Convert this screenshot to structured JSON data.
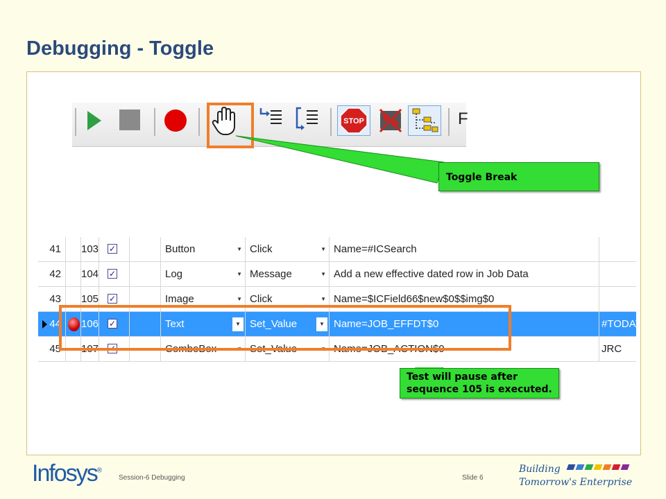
{
  "slide": {
    "title": "Debugging - Toggle"
  },
  "toolbar": {
    "items": [
      {
        "name": "run-icon",
        "color": "#2ea043"
      },
      {
        "name": "stop-icon",
        "color": "#8a8a8a"
      },
      {
        "name": "record-icon",
        "color": "#e00000"
      },
      {
        "name": "hand-icon",
        "color": "#222222"
      },
      {
        "name": "step-into-icon",
        "color": "#2a5db0"
      },
      {
        "name": "step-over-icon",
        "color": "#2a5db0"
      },
      {
        "name": "stop-sign-icon",
        "color": "#d41f1f"
      },
      {
        "name": "clear-breakpoints-icon",
        "color": "#cc2222"
      },
      {
        "name": "tree-icon",
        "color": "#2a5db0"
      }
    ],
    "truncated_label": "F"
  },
  "callouts": {
    "toggle_break": "Toggle Break",
    "pause_line1": "Test will pause after",
    "pause_line2": "sequence 105 is executed."
  },
  "grid": {
    "rows": [
      {
        "num": "41",
        "seq": "103",
        "checked": true,
        "object": "Button",
        "action": "Click",
        "target": "Name=#ICSearch",
        "value": "",
        "breakpoint": false,
        "selected": false
      },
      {
        "num": "42",
        "seq": "104",
        "checked": true,
        "object": "Log",
        "action": "Message",
        "target": "Add a new effective dated row in Job Data",
        "value": "",
        "breakpoint": false,
        "selected": false
      },
      {
        "num": "43",
        "seq": "105",
        "checked": true,
        "object": "Image",
        "action": "Click",
        "target": "Name=$ICField66$new$0$$img$0",
        "value": "",
        "breakpoint": false,
        "selected": false
      },
      {
        "num": "44",
        "seq": "106",
        "checked": true,
        "object": "Text",
        "action": "Set_Value",
        "target": "Name=JOB_EFFDT$0",
        "value": "#TODAY",
        "breakpoint": true,
        "selected": true
      },
      {
        "num": "45",
        "seq": "107",
        "checked": true,
        "object": "ComboBox",
        "action": "Set_Value",
        "target": "Name=JOB_ACTION$0",
        "value": "JRC",
        "breakpoint": false,
        "selected": false
      }
    ],
    "checkmark": "✓",
    "dropdown_glyph": "▼"
  },
  "footer": {
    "logo": "Infosys",
    "logo_mark": "®",
    "session": "Session-6 Debugging",
    "slide_label": "Slide 6",
    "tagline_line1": "Building",
    "tagline_line2": "Tomorrow's Enterprise",
    "tagline_colors": [
      "#2d4fa3",
      "#3a7fd0",
      "#2fa84f",
      "#f2c200",
      "#f07e2a",
      "#d02030",
      "#8a2a9a"
    ]
  }
}
